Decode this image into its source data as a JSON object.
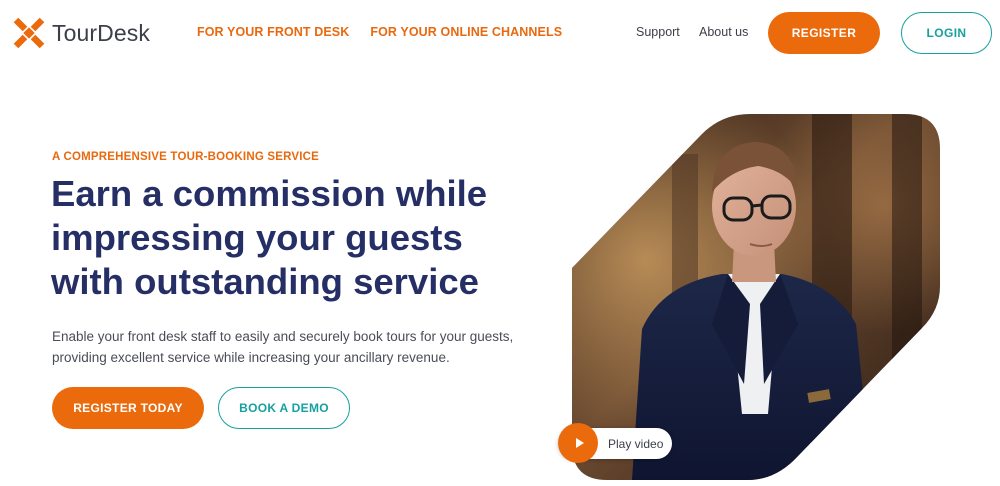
{
  "brand": {
    "name": "TourDesk",
    "accent_color": "#ea6a0c",
    "teal_color": "#17a0a0",
    "navy_color": "#252f66"
  },
  "nav": {
    "primary": [
      {
        "label": "FOR YOUR FRONT DESK"
      },
      {
        "label": "FOR YOUR ONLINE CHANNELS"
      }
    ],
    "secondary": [
      {
        "label": "Support"
      },
      {
        "label": "About us"
      }
    ],
    "register_label": "REGISTER",
    "login_label": "LOGIN"
  },
  "hero": {
    "eyebrow": "A COMPREHENSIVE TOUR-BOOKING SERVICE",
    "headline_lines": [
      "Earn a commission while",
      "impressing your guests",
      "with outstanding service"
    ],
    "lede_lines": [
      "Enable your front desk staff to easily and securely book tours for your guests,",
      "providing excellent service while increasing your ancillary revenue."
    ],
    "cta_primary": "REGISTER TODAY",
    "cta_secondary": "BOOK A DEMO",
    "video": {
      "play_label": "Play video",
      "play_icon": "play-icon"
    }
  }
}
